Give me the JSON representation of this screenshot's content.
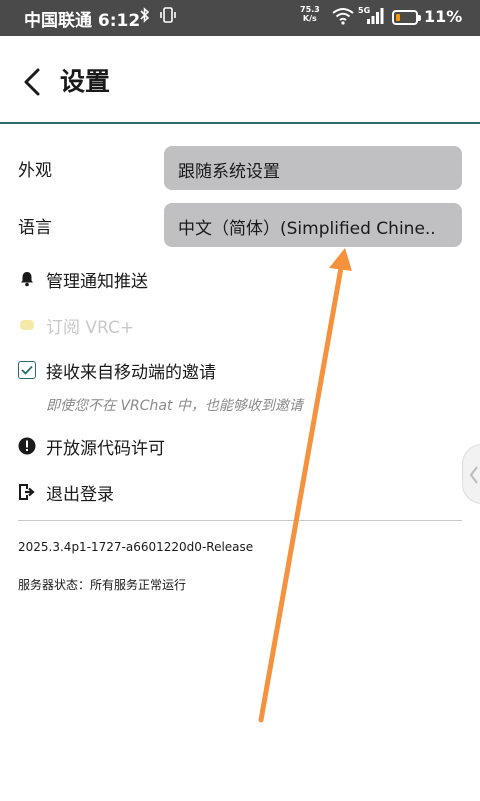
{
  "status_bar": {
    "carrier_time": "中国联通 6:12",
    "bluetooth_icon": "bluetooth-icon",
    "network_speed": "75.3",
    "network_speed_unit": "K/s",
    "network_type": "5G",
    "battery_percent": "11%",
    "battery_level": 0.11,
    "battery_color": "#ff9800"
  },
  "header": {
    "title": "设置"
  },
  "appearance": {
    "label": "外观",
    "value": "跟随系统设置"
  },
  "language": {
    "label": "语言",
    "value": "中文（简体）(Simplified Chine.."
  },
  "menu": {
    "notifications": "管理通知推送",
    "subscribe": "订阅 VRC+",
    "accept_invites": "接收来自移动端的邀请",
    "accept_invites_checked": true,
    "accept_invites_hint": "即使您不在 VRChat 中，也能够收到邀请",
    "open_source": "开放源代码许可",
    "logout": "退出登录"
  },
  "footer": {
    "version": "2025.3.4p1-1727-a6601220d0-Release",
    "server_status": "服务器状态：所有服务正常运行"
  },
  "colors": {
    "accent": "#2e6b6d",
    "select_bg": "#c0bfc2",
    "annotation_arrow": "#f5923e"
  }
}
